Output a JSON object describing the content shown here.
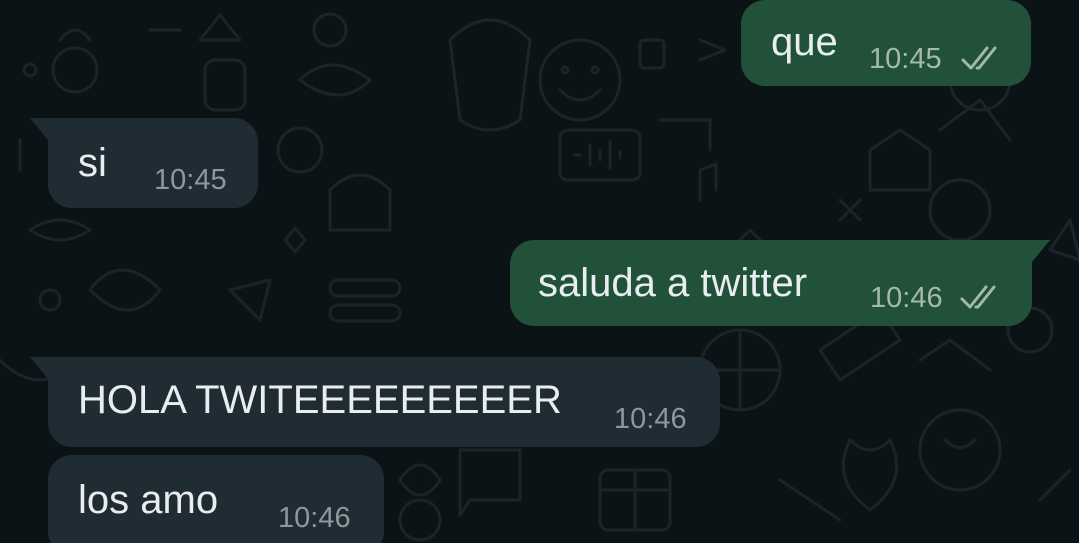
{
  "colors": {
    "background": "#0c1317",
    "incoming_bubble": "#202c33",
    "outgoing_bubble": "#215239",
    "text": "#e9edef",
    "timestamp": "#8d979c",
    "read_check": "#a4b9ad"
  },
  "messages": [
    {
      "direction": "outgoing",
      "text": "que",
      "time": "10:45",
      "status_icon": "double-check-icon"
    },
    {
      "direction": "incoming",
      "text": "si",
      "time": "10:45"
    },
    {
      "direction": "outgoing",
      "text": "saluda a twitter",
      "time": "10:46",
      "status_icon": "double-check-icon"
    },
    {
      "direction": "incoming",
      "text": "HOLA TWITEEEEEEEEER",
      "time": "10:46"
    },
    {
      "direction": "incoming",
      "text": "los amo",
      "time": "10:46"
    }
  ]
}
